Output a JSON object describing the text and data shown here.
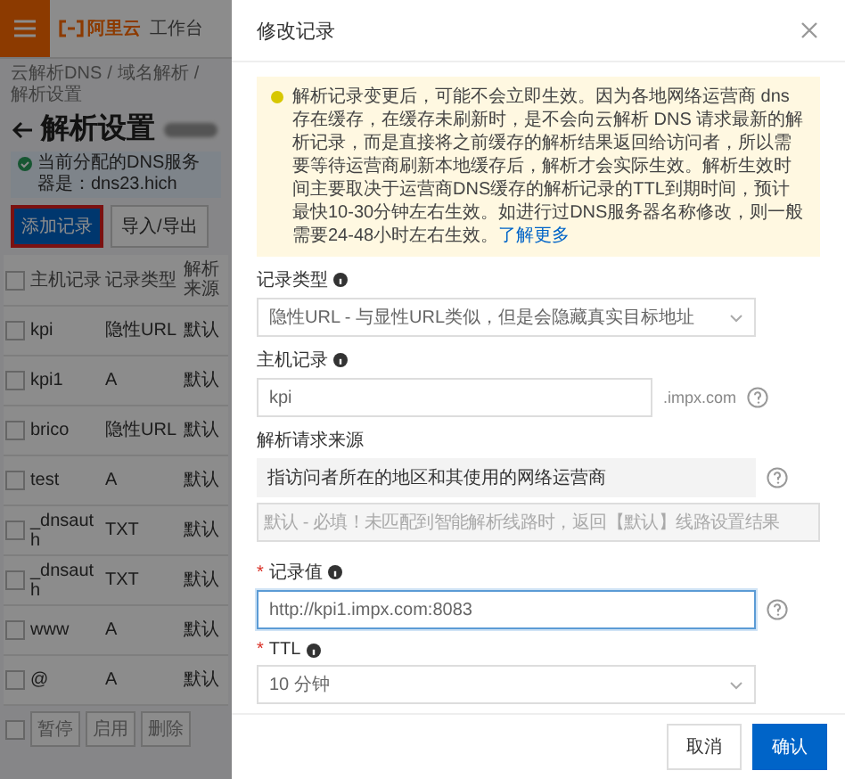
{
  "topbar": {
    "logo": "阿里云",
    "workbench": "工作台"
  },
  "breadcrumb": [
    {
      "label": "云解析DNS"
    },
    {
      "separator": "/",
      "label": "域名解析"
    },
    {
      "separator": "/",
      "label": "解析设置"
    }
  ],
  "page_title": "解析设置",
  "dns_notice": "当前分配的DNS服务器是：dns23.hich",
  "toolbar": [
    {
      "label": "添加记录",
      "primary": true,
      "highlighted": true
    },
    {
      "label": "导入/导出",
      "primary": false,
      "highlighted": false
    }
  ],
  "table": {
    "all_checked": false,
    "columns": [
      "主机记录",
      "记录类型",
      "解析来源"
    ],
    "rows": [
      {
        "checked": false,
        "host": "kpi",
        "type": "隐性URL",
        "line": "默认"
      },
      {
        "checked": false,
        "host": "kpi1",
        "type": "A",
        "line": "默认"
      },
      {
        "checked": false,
        "host": "brico",
        "type": "隐性URL",
        "line": "默认"
      },
      {
        "checked": false,
        "host": "test",
        "type": "A",
        "line": "默认"
      },
      {
        "checked": false,
        "host": "_dnsauth",
        "type": "TXT",
        "line": "默认"
      },
      {
        "checked": false,
        "host": "_dnsauth",
        "type": "TXT",
        "line": "默认"
      },
      {
        "checked": false,
        "host": "www",
        "type": "A",
        "line": "默认"
      },
      {
        "checked": false,
        "host": "@",
        "type": "A",
        "line": "默认"
      }
    ]
  },
  "batch": {
    "checked": false,
    "actions": [
      "暂停",
      "启用",
      "删除"
    ]
  },
  "drawer": {
    "title": "修改记录",
    "notice": {
      "text": "解析记录变更后，可能不会立即生效。因为各地网络运营商 dns 存在缓存，在缓存未刷新时，是不会向云解析 DNS 请求最新的解析记录，而是直接将之前缓存的解析结果返回给访问者，所以需要等待运营商刷新本地缓存后，解析才会实际生效。解析生效时间主要取决于运营商DNS缓存的解析记录的TTL到期时间，预计最快10-30分钟左右生效。如进行过DNS服务器名称修改，则一般需要24-48小时左右生效。",
      "link": "了解更多"
    },
    "fields": [
      {
        "kind": "select",
        "label": "记录类型",
        "info": true,
        "help": false,
        "value": "隐性URL - 与显性URL类似，但是会隐藏真实目标地址"
      },
      {
        "kind": "input",
        "label": "主机记录",
        "info": true,
        "help": true,
        "value": "kpi",
        "suffix": ".impx.com",
        "focused": false
      },
      {
        "kind": "source",
        "label": "解析请求来源",
        "info": false,
        "help": true,
        "description": "指访问者所在的地区和其使用的网络运营商",
        "placeholder": "默认 - 必填！未匹配到智能解析线路时，返回【默认】线路设置结果"
      },
      {
        "kind": "input",
        "required_mark": "*",
        "label": "记录值",
        "info": true,
        "help": true,
        "value": "http://kpi1.impx.com:8083",
        "focused": true
      },
      {
        "kind": "select",
        "required_mark": "*",
        "label": "TTL",
        "info": true,
        "help": false,
        "value": "10 分钟"
      }
    ],
    "buttons": [
      {
        "label": "取消",
        "primary": false
      },
      {
        "label": "确认",
        "primary": true
      }
    ]
  }
}
